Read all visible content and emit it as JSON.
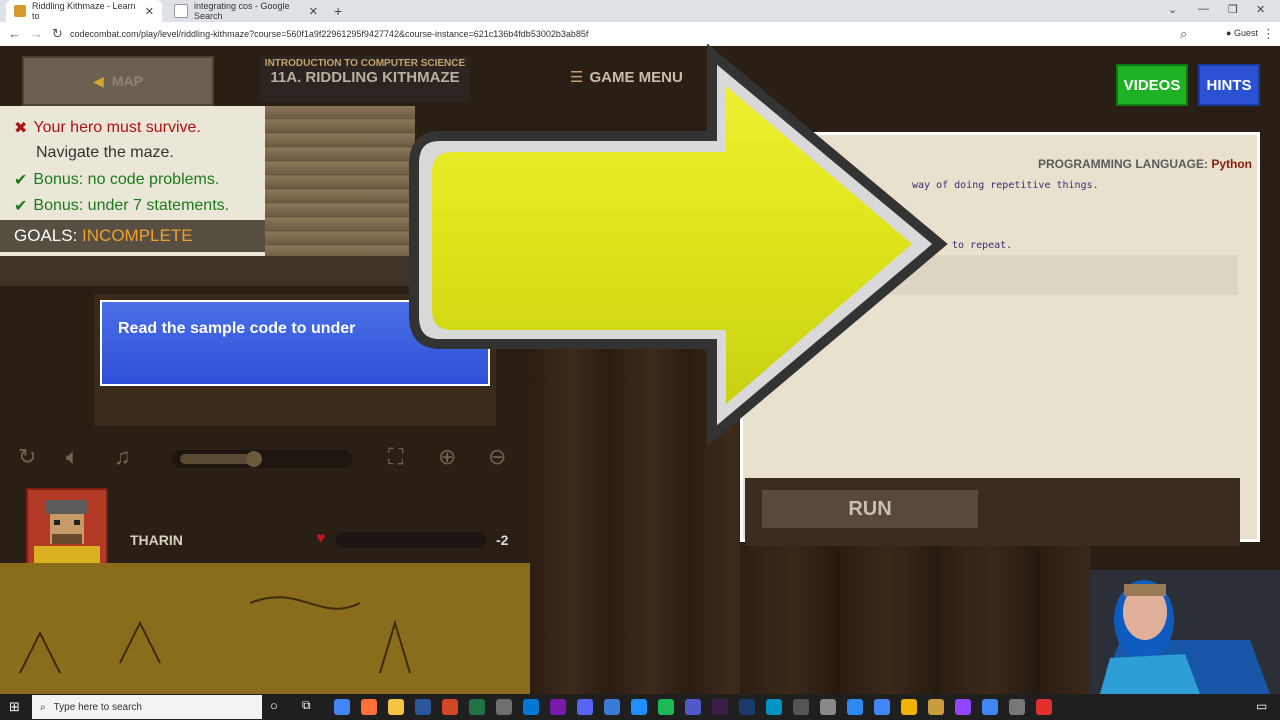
{
  "browser": {
    "tabs": [
      {
        "title": "Riddling Kithmaze - Learn to"
      },
      {
        "title": "integrating cos - Google Search"
      }
    ],
    "url": "codecombat.com/play/level/riddling-kithmaze?course=560f1a9f22961295f9427742&course-instance=621c136b4fdb53002b3ab85f",
    "profile": "Guest"
  },
  "game": {
    "map_label": "MAP",
    "course": "INTRODUCTION TO COMPUTER SCIENCE",
    "level": "11A. RIDDLING KITHMAZE",
    "menu_label": "GAME MENU",
    "goals": [
      {
        "text": "Your hero must survive.",
        "status": "fail"
      },
      {
        "text": "Navigate the maze.",
        "status": "none"
      },
      {
        "text": "Bonus: no code problems.",
        "status": "ok"
      },
      {
        "text": "Bonus: under 7 statements.",
        "status": "ok"
      }
    ],
    "goals_label": "GOALS:",
    "goals_state": "INCOMPLETE",
    "tip_text": "Read the sample code to under",
    "hero_name": "THARIN",
    "health_value": "-2",
    "videos_label": "VIDEOS",
    "hints_label": "HINTS",
    "language_label": "PROGRAMMING LANGUAGE:",
    "language": "Python",
    "code_lines": [
      "way of doing repetitive things.",
      "to repeat."
    ],
    "run_label": "RUN"
  },
  "taskbar": {
    "search_placeholder": "Type here to search"
  },
  "colors": {
    "hints_blue": "#2b52d4",
    "videos_green": "#1fb124",
    "arrow_yellow": "#e4ef1e",
    "incomplete": "#f0a030"
  }
}
